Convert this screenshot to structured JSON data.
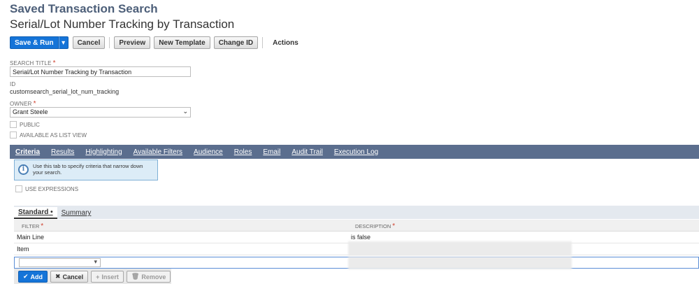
{
  "header": {
    "page_kind": "Saved Transaction Search",
    "page_title": "Serial/Lot Number Tracking by Transaction"
  },
  "toolbar": {
    "save_run": "Save & Run",
    "cancel": "Cancel",
    "preview": "Preview",
    "new_template": "New Template",
    "change_id": "Change ID",
    "actions": "Actions"
  },
  "form": {
    "search_title_label": "SEARCH TITLE",
    "search_title_value": "Serial/Lot Number Tracking by Transaction",
    "id_label": "ID",
    "id_value": "customsearch_serial_lot_num_tracking",
    "owner_label": "OWNER",
    "owner_value": "Grant Steele",
    "public_label": "PUBLIC",
    "available_list_label": "AVAILABLE AS LIST VIEW",
    "required_mark": "*"
  },
  "tabs": [
    "Criteria",
    "Results",
    "Highlighting",
    "Available Filters",
    "Audience",
    "Roles",
    "Email",
    "Audit Trail",
    "Execution Log"
  ],
  "criteria": {
    "tooltip": "Use this tab to specify criteria that narrow down your search.",
    "use_expressions_label": "USE EXPRESSIONS",
    "subtabs": {
      "standard": "Standard",
      "summary": "Summary"
    },
    "columns": {
      "filter": "FILTER",
      "description": "DESCRIPTION"
    },
    "rows": [
      {
        "filter": "Main Line",
        "description": "is false"
      },
      {
        "filter": "Item",
        "description": ""
      }
    ],
    "buttons": {
      "add": "Add",
      "cancel": "Cancel",
      "insert": "Insert",
      "remove": "Remove"
    }
  },
  "colors": {
    "primary": "#1574d8",
    "tabbar": "#5b6e8e",
    "heading": "#4d5f79"
  }
}
